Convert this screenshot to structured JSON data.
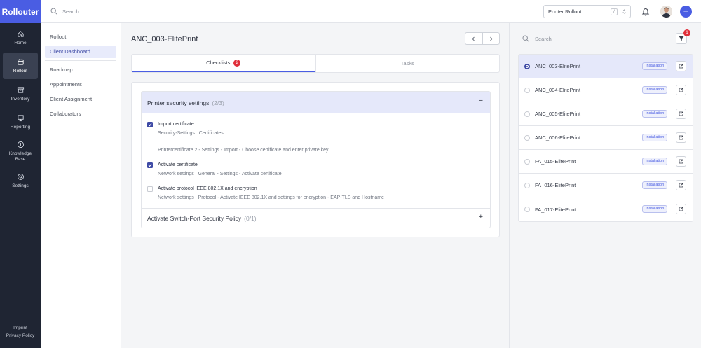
{
  "app": {
    "logo": "Rollouter"
  },
  "leftnav": {
    "items": [
      {
        "label": "Home",
        "icon": "home-icon"
      },
      {
        "label": "Rollout",
        "icon": "calendar-icon"
      },
      {
        "label": "Inventory",
        "icon": "archive-icon"
      },
      {
        "label": "Reporting",
        "icon": "report-icon"
      },
      {
        "label": "Knowledge Base",
        "icon": "info-icon"
      },
      {
        "label": "Settings",
        "icon": "gear-icon"
      }
    ],
    "active": "Rollout",
    "footer": {
      "imprint": "Imprint",
      "privacy": "Privacy Policy"
    }
  },
  "header": {
    "search_placeholder": "Search",
    "project": "Printer Rollout",
    "shortcut": "/"
  },
  "subnav": {
    "items": [
      "Rollout",
      "Client Dashboard",
      "Roadmap",
      "Appointments",
      "Client Assignment",
      "Collaborators"
    ],
    "active": "Client Dashboard"
  },
  "main": {
    "title": "ANC_003-ElitePrint",
    "tabs": [
      {
        "label": "Checklists",
        "badge": "2"
      },
      {
        "label": "Tasks"
      }
    ],
    "sections": [
      {
        "title": "Printer security settings",
        "count": "(2/3)",
        "toggle": "−",
        "items": [
          {
            "title": "Import certificate",
            "desc": "Security-Settings : Certificates",
            "checked": true
          },
          {
            "title": "Activate certificate",
            "desc": "Network settings : General - Settings - Activate certificate",
            "checked": true
          },
          {
            "title": "Activate protocol IEEE 802.1X and encryption",
            "desc": "Network settings : Protocol - Activate IEEE 802.1X and settings for encryption - EAP-TLS and Hostname",
            "checked": false
          }
        ],
        "note": "Printercertificate 2 - Settings - Import - Choose certificate and enter private key"
      },
      {
        "title": "Activate Switch-Port Security Policy",
        "count": "(0/1)",
        "toggle": "+"
      }
    ]
  },
  "rightpanel": {
    "search_placeholder": "Search",
    "filter_badge": "1",
    "devices": [
      {
        "name": "ANC_003-ElitePrint",
        "tag": "Installation",
        "selected": true
      },
      {
        "name": "ANC_004-ElitePrint",
        "tag": "Installation",
        "selected": false
      },
      {
        "name": "ANC_005-ElitePrint",
        "tag": "Installation",
        "selected": false
      },
      {
        "name": "ANC_006-ElitePrint",
        "tag": "Installation",
        "selected": false
      },
      {
        "name": "FA_015-ElitePrint",
        "tag": "Installation",
        "selected": false
      },
      {
        "name": "FA_016-ElitePrint",
        "tag": "Installation",
        "selected": false
      },
      {
        "name": "FA_017-ElitePrint",
        "tag": "Installation",
        "selected": false
      }
    ]
  },
  "colors": {
    "accent": "#4a5de3",
    "sidebar": "#1f2533",
    "badge": "#e02f3a",
    "selected_bg": "#e5e8fa"
  }
}
